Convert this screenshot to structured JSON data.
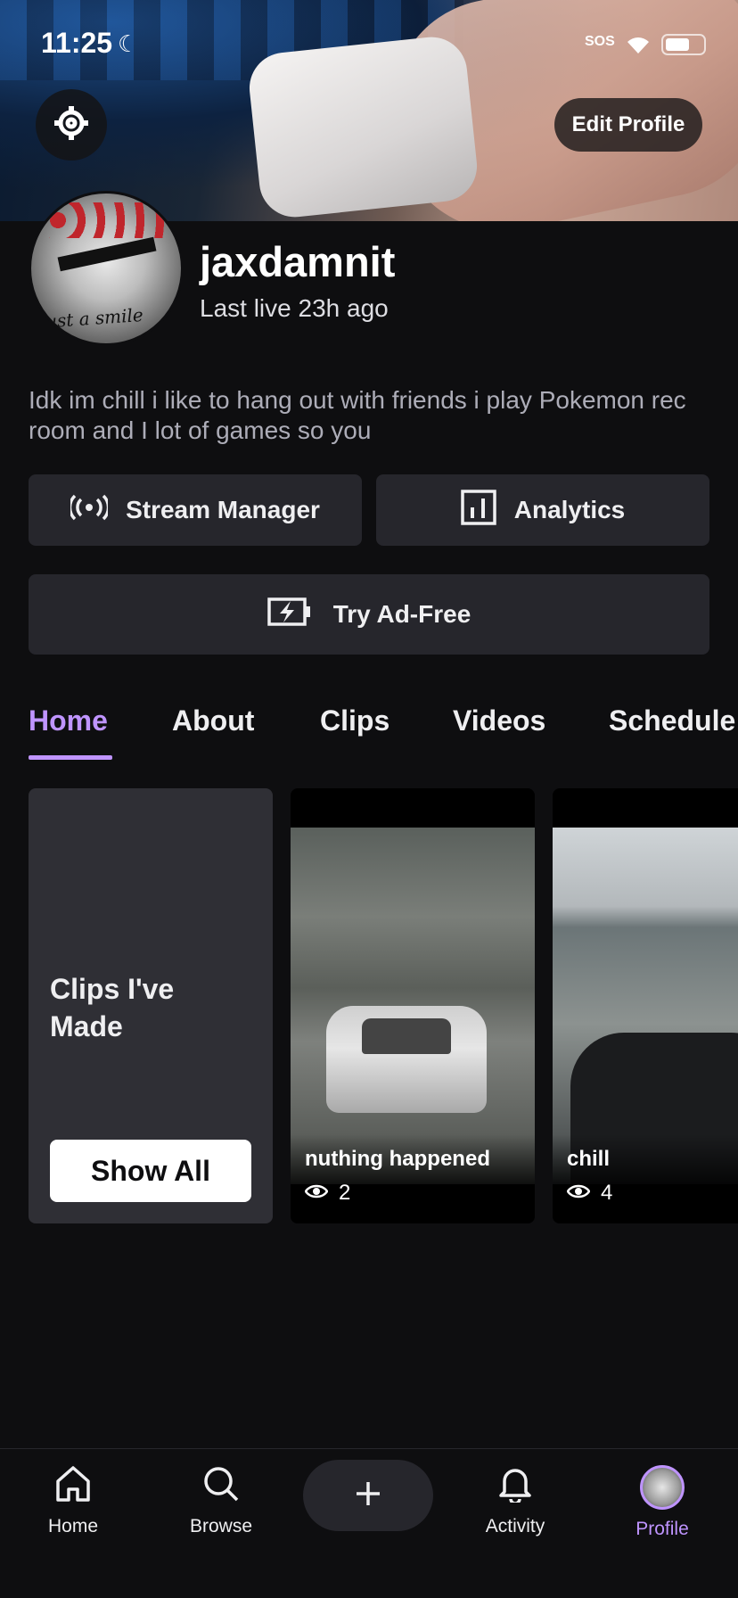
{
  "status_bar": {
    "time": "11:25",
    "sos": "SOS"
  },
  "header": {
    "edit_profile": "Edit Profile"
  },
  "profile": {
    "username": "jaxdamnit",
    "last_live": "Last live 23h ago",
    "bio": "Idk im chill i like to hang out with friends i play Pokemon rec room and I lot of games so you",
    "avatar_text": "Just a smile"
  },
  "actions": {
    "stream_manager": "Stream Manager",
    "analytics": "Analytics",
    "try_ad_free": "Try Ad-Free"
  },
  "tabs": [
    {
      "label": "Home",
      "active": true
    },
    {
      "label": "About"
    },
    {
      "label": "Clips"
    },
    {
      "label": "Videos"
    },
    {
      "label": "Schedule"
    }
  ],
  "clips_section": {
    "title": "Clips I've Made",
    "show_all": "Show All",
    "clips": [
      {
        "title": "nuthing happened",
        "views": "2"
      },
      {
        "title": "chill",
        "views": "4"
      }
    ]
  },
  "nav": {
    "home": "Home",
    "browse": "Browse",
    "activity": "Activity",
    "profile": "Profile"
  },
  "colors": {
    "accent": "#bf94ff",
    "background": "#0e0e10",
    "surface": "#26262c"
  },
  "icons": [
    "gear-icon",
    "broadcast-icon",
    "analytics-icon",
    "battery-bolt-icon",
    "eye-icon",
    "home-icon",
    "search-icon",
    "plus-icon",
    "bell-icon"
  ]
}
